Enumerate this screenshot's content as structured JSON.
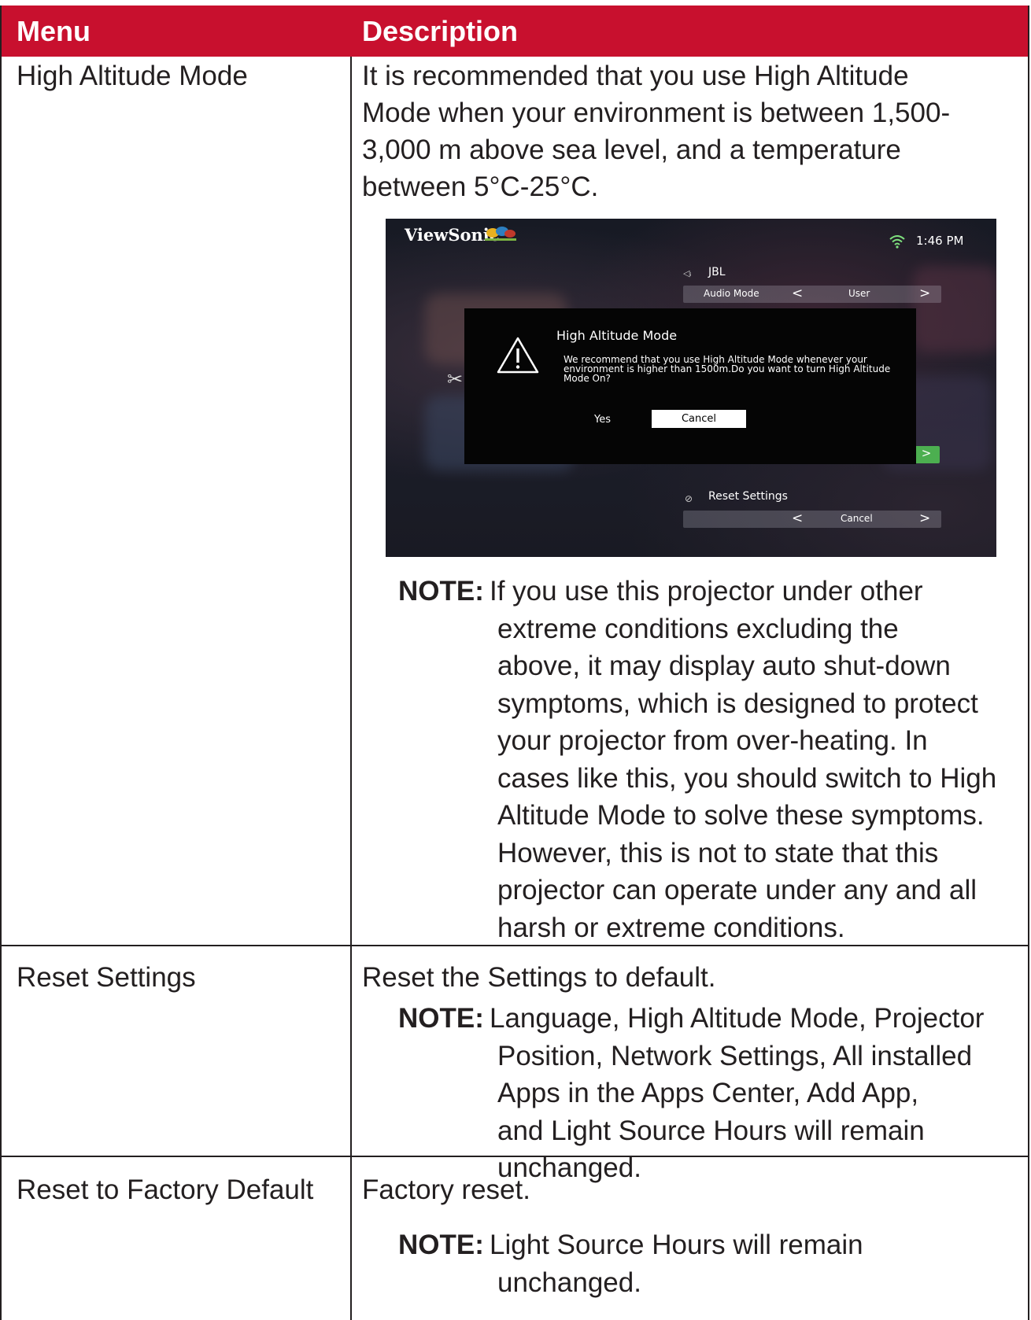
{
  "header": {
    "menu": "Menu",
    "description": "Description"
  },
  "rows": [
    {
      "menu": "High Altitude Mode",
      "desc_lines": [
        "It is recommended that you use High Altitude",
        "Mode when your environment is between 1,500-",
        "3,000 m above sea level, and a temperature",
        "between 5°C-25°C."
      ],
      "note_label": "NOTE:",
      "note_lines": [
        "If you use this projector under other",
        "extreme conditions excluding the",
        "above, it may display auto shut-down",
        "symptoms, which is designed to protect",
        "your projector from over-heating. In",
        "cases like this, you should switch to High",
        "Altitude Mode to solve these symptoms.",
        "However, this is not to state that this",
        "projector can operate under any and all",
        "harsh or extreme conditions."
      ]
    },
    {
      "menu": "Reset Settings",
      "desc": "Reset the Settings to default.",
      "note_label": "NOTE:",
      "note_lines": [
        "Language, High Altitude Mode, Projector",
        "Position, Network Settings, All installed",
        "Apps in the Apps Center, Add App,",
        "and Light Source Hours will remain",
        "unchanged."
      ]
    },
    {
      "menu": "Reset to Factory Default",
      "desc": "Factory reset.",
      "note_label": "NOTE:",
      "note_lines": [
        "Light Source Hours will remain",
        "unchanged."
      ]
    }
  ],
  "screenshot": {
    "brand": "ViewSonic",
    "time": "1:46 PM",
    "speaker": "JBL",
    "audio_mode_label": "Audio Mode",
    "audio_mode_value": "User",
    "dialog_title": "High Altitude Mode",
    "dialog_message": "We recommend that you use High Altitude Mode whenever your environment is higher than 1500m.Do you want to turn High Altitude Mode On?",
    "yes": "Yes",
    "cancel": "Cancel",
    "reset_label": "Reset Settings",
    "reset_value": "Cancel",
    "chevron_left": "<",
    "chevron_right": ">"
  },
  "colors": {
    "header_bg": "#c8102e",
    "header_text": "#ffffff",
    "text": "#231f20"
  }
}
